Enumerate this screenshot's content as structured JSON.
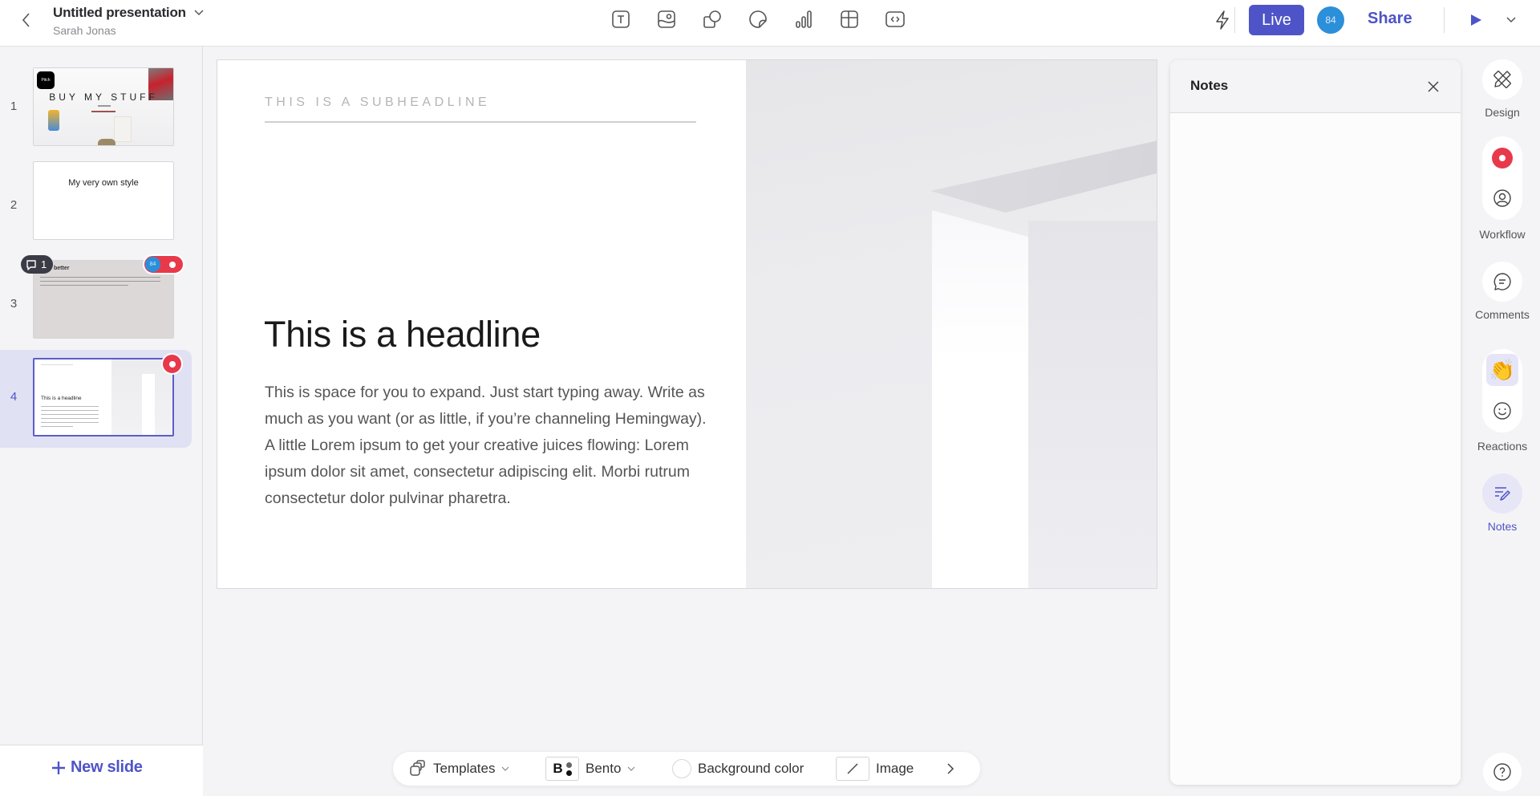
{
  "app": {
    "title": "Untitled presentation",
    "owner": "Sarah Jonas"
  },
  "toolbar": {
    "insert_tools": [
      {
        "name": "text",
        "icon": "text-icon"
      },
      {
        "name": "image",
        "icon": "image-icon"
      },
      {
        "name": "shapes",
        "icon": "shapes-icon"
      },
      {
        "name": "sticker",
        "icon": "sticker-icon"
      },
      {
        "name": "chart",
        "icon": "chart-icon"
      },
      {
        "name": "table",
        "icon": "table-icon"
      },
      {
        "name": "embed",
        "icon": "embed-icon"
      }
    ],
    "live_label": "Live",
    "avatar_label": "84",
    "share_label": "Share"
  },
  "slides": [
    {
      "number": "1",
      "title": "BUY MY STUFF",
      "logo_text": "Pitch"
    },
    {
      "number": "2",
      "title": "My very own style"
    },
    {
      "number": "3",
      "title": "better",
      "comment_count": "1",
      "presence_avatar": "84"
    },
    {
      "number": "4",
      "title": "This is a headline",
      "selected": true
    }
  ],
  "new_slide_label": "New slide",
  "slide": {
    "subheadline": "THIS IS A SUBHEADLINE",
    "headline": "This is a headline",
    "body": "This is space for you to expand. Just start typing away. Write as much as you want (or as little, if you’re channeling Hemingway). A little Lorem ipsum to get your creative juices flowing: Lorem ipsum dolor sit amet, consectetur adipiscing elit. Morbi rutrum consectetur dolor pulvinar pharetra."
  },
  "bottom_toolbar": {
    "templates_label": "Templates",
    "theme_label": "Bento",
    "theme_letter": "B",
    "background_label": "Background color",
    "image_label": "Image"
  },
  "notes": {
    "title": "Notes",
    "value": ""
  },
  "rail": {
    "design_label": "Design",
    "workflow_label": "Workflow",
    "comments_label": "Comments",
    "reactions_label": "Reactions",
    "reaction_emoji": "👏",
    "notes_label": "Notes"
  },
  "colors": {
    "accent": "#4e54c8",
    "record": "#e8394b",
    "avatar": "#2b8fd9"
  }
}
